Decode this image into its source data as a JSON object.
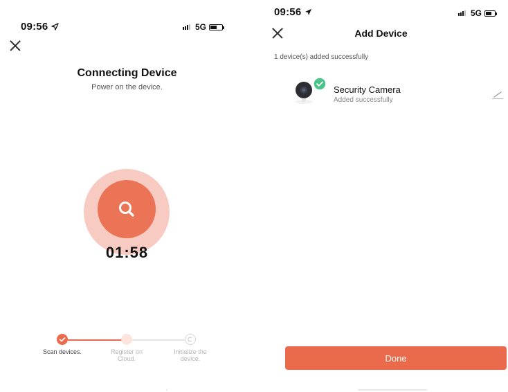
{
  "left": {
    "status": {
      "time": "09:56",
      "network": "5G"
    },
    "title": "Connecting Device",
    "subtitle": "Power on the device.",
    "timer": "01:58",
    "steps": [
      {
        "label": "Scan devices.",
        "state": "done"
      },
      {
        "label": "Register on Cloud.",
        "state": "active"
      },
      {
        "label": "Initialize the device.",
        "state": "pending"
      }
    ],
    "icons": {
      "close": "close-icon",
      "search": "search-icon",
      "location": "location-arrow-icon"
    }
  },
  "right": {
    "status": {
      "time": "09:56",
      "network": "5G"
    },
    "title": "Add Device",
    "added_note": "1 device(s) added successfully",
    "device": {
      "name": "Security Camera",
      "status": "Added successfully"
    },
    "done_label": "Done",
    "icons": {
      "close": "close-icon",
      "edit": "edit-pencil-icon",
      "check": "check-badge-icon",
      "camera": "security-camera-icon"
    }
  },
  "colors": {
    "accent": "#ea6a4c",
    "ring_light": "#f7cbc2",
    "check_green": "#4cc38a"
  }
}
